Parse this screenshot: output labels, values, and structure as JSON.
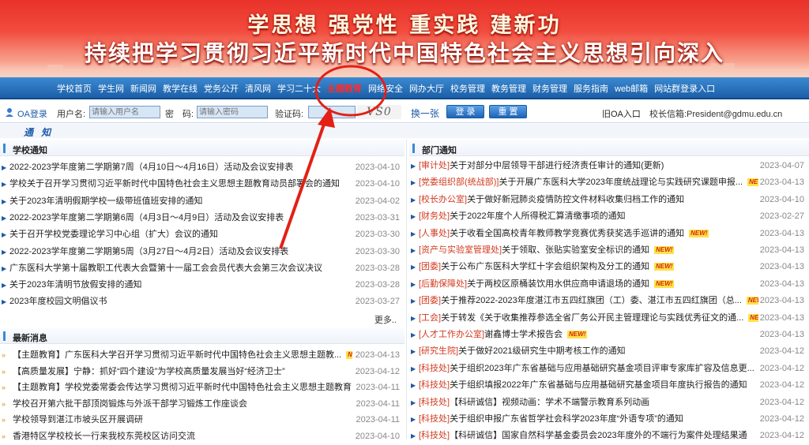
{
  "banner": {
    "line1": "学思想  强党性  重实践  建新功",
    "line2": "持续把学习贯彻习近平新时代中国特色社会主义思想引向深入"
  },
  "nav": {
    "items": [
      "学校首页",
      "学生网",
      "新闻网",
      "教学在线",
      "党务公开",
      "清风网",
      "学习二十大",
      "主题教育",
      "网络安全",
      "网办大厅",
      "校务管理",
      "教务管理",
      "财务管理",
      "服务指南",
      "web邮箱",
      "网站群登录入口"
    ],
    "highlight_index": 7
  },
  "login": {
    "oa_label": "OA登录",
    "username_label": "用户名:",
    "username_placeholder": "请输入用户名",
    "password_label": "密　码:",
    "password_placeholder": "请输入密码",
    "captcha_label": "验证码:",
    "captcha_text": "VS0",
    "refresh_label": "换一张",
    "login_button": "登 录",
    "reset_button": "重 置",
    "old_oa": "旧OA入口",
    "mailbox": "校长信箱:President@gdmu.edu.cn"
  },
  "section_banner": "通 知",
  "school_notice": {
    "title": "学校通知",
    "more": "更多..",
    "items": [
      {
        "text": "2022-2023学年度第二学期第7周（4月10日～4月16日）活动及会议安排表",
        "date": "2023-04-10"
      },
      {
        "text": "学校关于召开学习贯彻习近平新时代中国特色社会主义思想主题教育动员部署会的通知",
        "date": "2023-04-10"
      },
      {
        "text": "关于2023年清明假期学校一级带班值班安排的通知",
        "date": "2023-04-02"
      },
      {
        "text": "2022-2023学年度第二学期第6周（4月3日～4月9日）活动及会议安排表",
        "date": "2023-03-31"
      },
      {
        "text": "关于召开学校党委理论学习中心组（扩大）会议的通知",
        "date": "2023-03-30"
      },
      {
        "text": "2022-2023学年度第二学期第5周（3月27日～4月2日）活动及会议安排表",
        "date": "2023-03-30"
      },
      {
        "text": "广东医科大学第十届教职工代表大会暨第十一届工会会员代表大会第三次会议决议",
        "date": "2023-03-28"
      },
      {
        "text": "关于2023年清明节放假安排的通知",
        "date": "2023-03-28"
      },
      {
        "text": "2023年度校园文明倡议书",
        "date": "2023-03-27"
      }
    ]
  },
  "latest_news": {
    "title": "最新消息",
    "items": [
      {
        "text": "【主题教育】广东医科大学召开学习贯彻习近平新时代中国特色社会主义思想主题教...",
        "date": "2023-04-13",
        "new": true
      },
      {
        "text": "【高质量发展】宁静：抓好“四个建设”为学校高质量发展当好“经济卫士”",
        "date": "2023-04-12",
        "new": false
      },
      {
        "text": "【主题教育】学校党委常委会传达学习贯彻习近平新时代中国特色社会主义思想主题教育...",
        "date": "2023-04-11",
        "new": false
      },
      {
        "text": "学校召开第六批干部顶岗锻炼与外派干部学习锻炼工作座谈会",
        "date": "2023-04-11",
        "new": false
      },
      {
        "text": "学校领导到湛江市坡头区开展调研",
        "date": "2023-04-11",
        "new": false
      },
      {
        "text": "香港特区学校校长一行来我校东莞校区访问交流",
        "date": "2023-04-10",
        "new": false
      }
    ]
  },
  "dept_notice": {
    "title": "部门通知",
    "items": [
      {
        "tag": "[审计处]",
        "text": "关于对部分中层领导干部进行经济责任审计的通知(更新)",
        "date": "2023-04-07",
        "new": false
      },
      {
        "tag": "[党委组织部(统战部)]",
        "text": "关于开展广东医科大学2023年度统战理论与实践研究课题申报...",
        "date": "2023-04-13",
        "new": true
      },
      {
        "tag": "[校长办公室]",
        "text": "关于做好新冠肺炎疫情防控文件材料收集归档工作的通知",
        "date": "2023-04-10",
        "new": false
      },
      {
        "tag": "[财务处]",
        "text": "关于2022年度个人所得税汇算清缴事项的通知",
        "date": "2023-02-27",
        "new": false
      },
      {
        "tag": "[人事处]",
        "text": "关于收看全国高校青年教师教学竞赛优秀获奖选手巡讲的通知",
        "date": "2023-04-13",
        "new": true
      },
      {
        "tag": "[资产与实验室管理处]",
        "text": "关于领取、张贴实验室安全标识的通知",
        "date": "2023-04-13",
        "new": true
      },
      {
        "tag": "[团委]",
        "text": "关于公布广东医科大学红十字会组织架构及分工的通知",
        "date": "2023-04-13",
        "new": true
      },
      {
        "tag": "[后勤保障处]",
        "text": "关于两校区原桶装饮用水供应商申请退场的通知",
        "date": "2023-04-13",
        "new": true
      },
      {
        "tag": "[团委]",
        "text": "关于推荐2022-2023年度湛江市五四红旗团（工）委、湛江市五四红旗团（总...",
        "date": "2023-04-13",
        "new": true
      },
      {
        "tag": "[工会]",
        "text": "关于转发《关于收集推荐参选全省厂务公开民主管理理论与实践优秀征文的通...",
        "date": "2023-04-13",
        "new": true
      },
      {
        "tag": "[人才工作办公室]",
        "text": "谢鑫博士学术报告会",
        "date": "2023-04-13",
        "new": true
      },
      {
        "tag": "[研究生院]",
        "text": "关于做好2021级研究生中期考核工作的通知",
        "date": "2023-04-12",
        "new": false
      },
      {
        "tag": "[科技处]",
        "text": "关于组织2023年广东省基础与应用基础研究基金项目评审专家库扩容及信息更...",
        "date": "2023-04-12",
        "new": false
      },
      {
        "tag": "[科技处]",
        "text": "关于组织填报2022年广东省基础与应用基础研究基金项目年度执行报告的通知",
        "date": "2023-04-12",
        "new": false
      },
      {
        "tag": "[科技处]",
        "text": "【科研诚信】视频动画：学术不端警示教育系列动画",
        "date": "2023-04-12",
        "new": false
      },
      {
        "tag": "[科技处]",
        "text": "关于组织申报广东省哲学社会科学2023年度“外语专项”的通知",
        "date": "2023-04-12",
        "new": false
      },
      {
        "tag": "[科技处]",
        "text": "【科研诚信】国家自然科学基金委员会2023年度外的不端行为案件处理结果通",
        "date": "2023-04-12",
        "new": false
      }
    ]
  },
  "annotation": {
    "color": "#e32016"
  },
  "new_badge": "NEW!"
}
